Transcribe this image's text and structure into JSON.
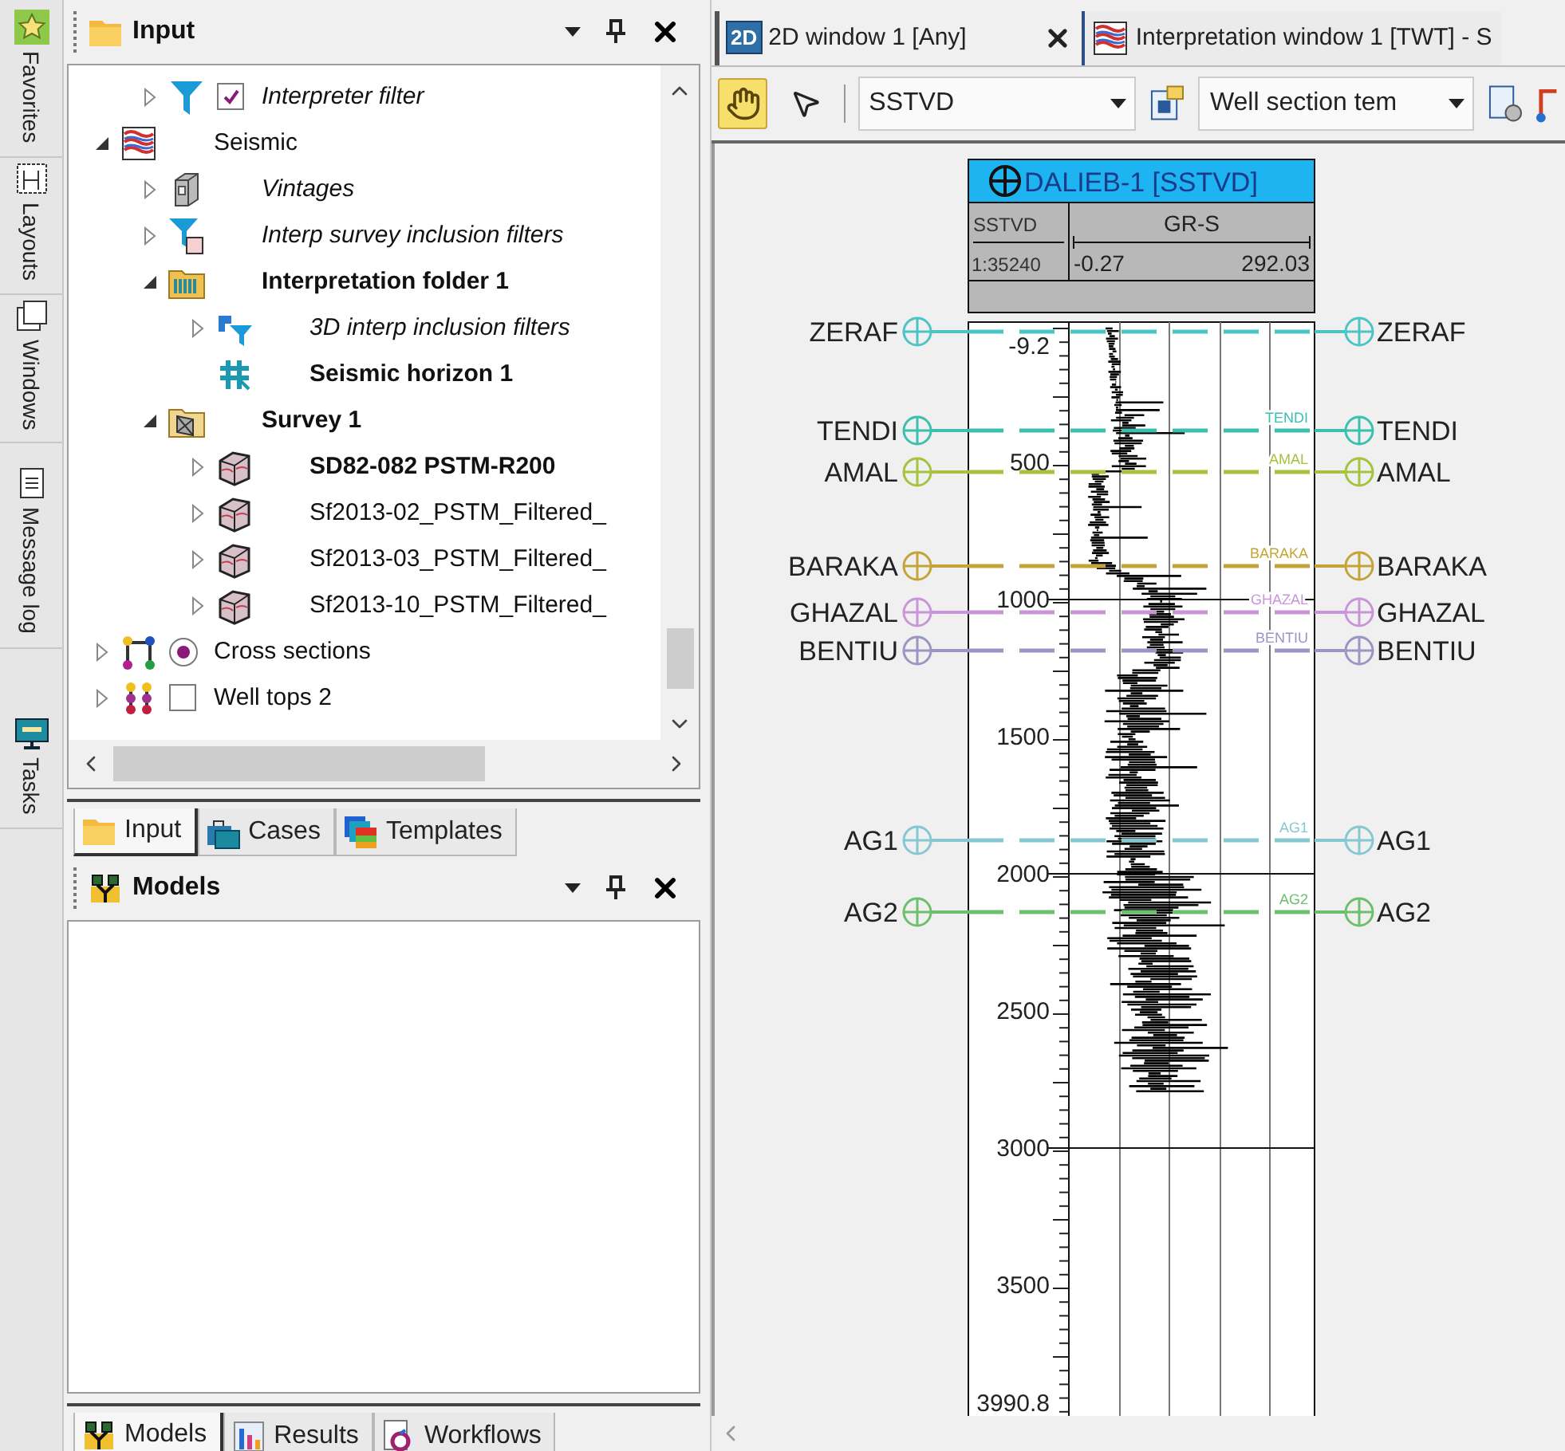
{
  "side_tabs": [
    {
      "label": "Favorites"
    },
    {
      "label": "Layouts"
    },
    {
      "label": "Windows"
    },
    {
      "label": "Message log"
    },
    {
      "label": "Tasks"
    }
  ],
  "input_panel": {
    "title": "Input",
    "tree": {
      "hidden_parent_children": [
        {
          "label": "Interpreter filter",
          "kind": "filter",
          "active": false,
          "expanded": false,
          "checked": true
        }
      ],
      "items": [
        {
          "label": "Seismic",
          "kind": "seismic",
          "active": false,
          "expanded": true,
          "children": [
            {
              "label": "Vintages",
              "kind": "vintages",
              "active": false,
              "expanded": false
            },
            {
              "label": "Interp survey inclusion filters",
              "kind": "surveyfilter",
              "active": false,
              "expanded": false
            },
            {
              "label": "Interpretation folder 1",
              "kind": "interpfolder",
              "active": true,
              "expanded": true,
              "children": [
                {
                  "label": "3D interp inclusion filters",
                  "kind": "filter3d",
                  "active": false,
                  "expanded": false
                },
                {
                  "label": "Seismic horizon 1",
                  "kind": "horizon",
                  "active": true
                }
              ]
            },
            {
              "label": "Survey 1",
              "kind": "survey",
              "active": true,
              "expanded": true,
              "children": [
                {
                  "label": "SD82-082 PSTM-R200",
                  "kind": "cube",
                  "active": true,
                  "expanded": false
                },
                {
                  "label": "Sf2013-02_PSTM_Filtered_",
                  "kind": "cube",
                  "active": false,
                  "expanded": false
                },
                {
                  "label": "Sf2013-03_PSTM_Filtered_",
                  "kind": "cube",
                  "active": false,
                  "expanded": false
                },
                {
                  "label": "Sf2013-10_PSTM_Filtered_",
                  "kind": "cube",
                  "active": false,
                  "expanded": false
                }
              ]
            }
          ]
        },
        {
          "label": "Cross sections",
          "kind": "crosssection",
          "active": false,
          "expanded": false,
          "radio_checked": true
        },
        {
          "label": "Well tops 2",
          "kind": "welltops",
          "active": false,
          "expanded": false,
          "checked": false
        }
      ]
    },
    "tabs": [
      {
        "label": "Input",
        "selected": true
      },
      {
        "label": "Cases",
        "selected": false
      },
      {
        "label": "Templates",
        "selected": false
      }
    ]
  },
  "models_panel": {
    "title": "Models",
    "tabs": [
      {
        "label": "Models",
        "selected": true
      },
      {
        "label": "Results",
        "selected": false
      },
      {
        "label": "Workflows",
        "selected": false
      }
    ]
  },
  "document_tabs": [
    {
      "label": "2D window 1 [Any]",
      "badge": "2D",
      "selected": true
    },
    {
      "label": "Interpretation window 1 [TWT] - S",
      "selected": false
    }
  ],
  "toolbar": {
    "tools": [
      {
        "selected": true
      },
      {
        "selected": false
      }
    ],
    "domain_select": "SSTVD",
    "template_select": "Well section tem"
  },
  "well_section": {
    "well": {
      "name": "DALIEB-1 [SSTVD]",
      "depth_header": "SSTVD",
      "scale": "1:35240",
      "log": "GR-S",
      "min": "-0.27",
      "max": "292.03"
    },
    "depth_labels": [
      "-9.2",
      "500",
      "1000",
      "1500",
      "2000",
      "2500",
      "3000",
      "3500",
      "3990.8"
    ],
    "tops": [
      {
        "left_label": "ZERAF",
        "right_label": "ZERAF",
        "color": "#4cc4c4"
      },
      {
        "left_label": "TENDI",
        "right_label": "TENDI",
        "track_label": "TENDI",
        "color": "#3cc0ae"
      },
      {
        "left_label": "AMAL",
        "right_label": "AMAL",
        "track_label": "AMAL",
        "color": "#a6c23e"
      },
      {
        "left_label": "BARAKA",
        "right_label": "BARAKA",
        "track_label": "BARAKA",
        "color": "#c4a436"
      },
      {
        "left_label": "GHAZAL",
        "right_label": "GHAZAL",
        "track_label": "GHAZAL",
        "color": "#c896d8"
      },
      {
        "left_label": "BENTIU",
        "right_label": "BENTIU",
        "track_label": "BENTIU",
        "color": "#9a96c4"
      },
      {
        "left_label": "AG1",
        "right_label": "AG1",
        "track_label": "AG1",
        "color": "#86c8d2"
      },
      {
        "left_label": "AG2",
        "right_label": "AG2",
        "track_label": "AG2",
        "color": "#6cc06c"
      }
    ]
  }
}
